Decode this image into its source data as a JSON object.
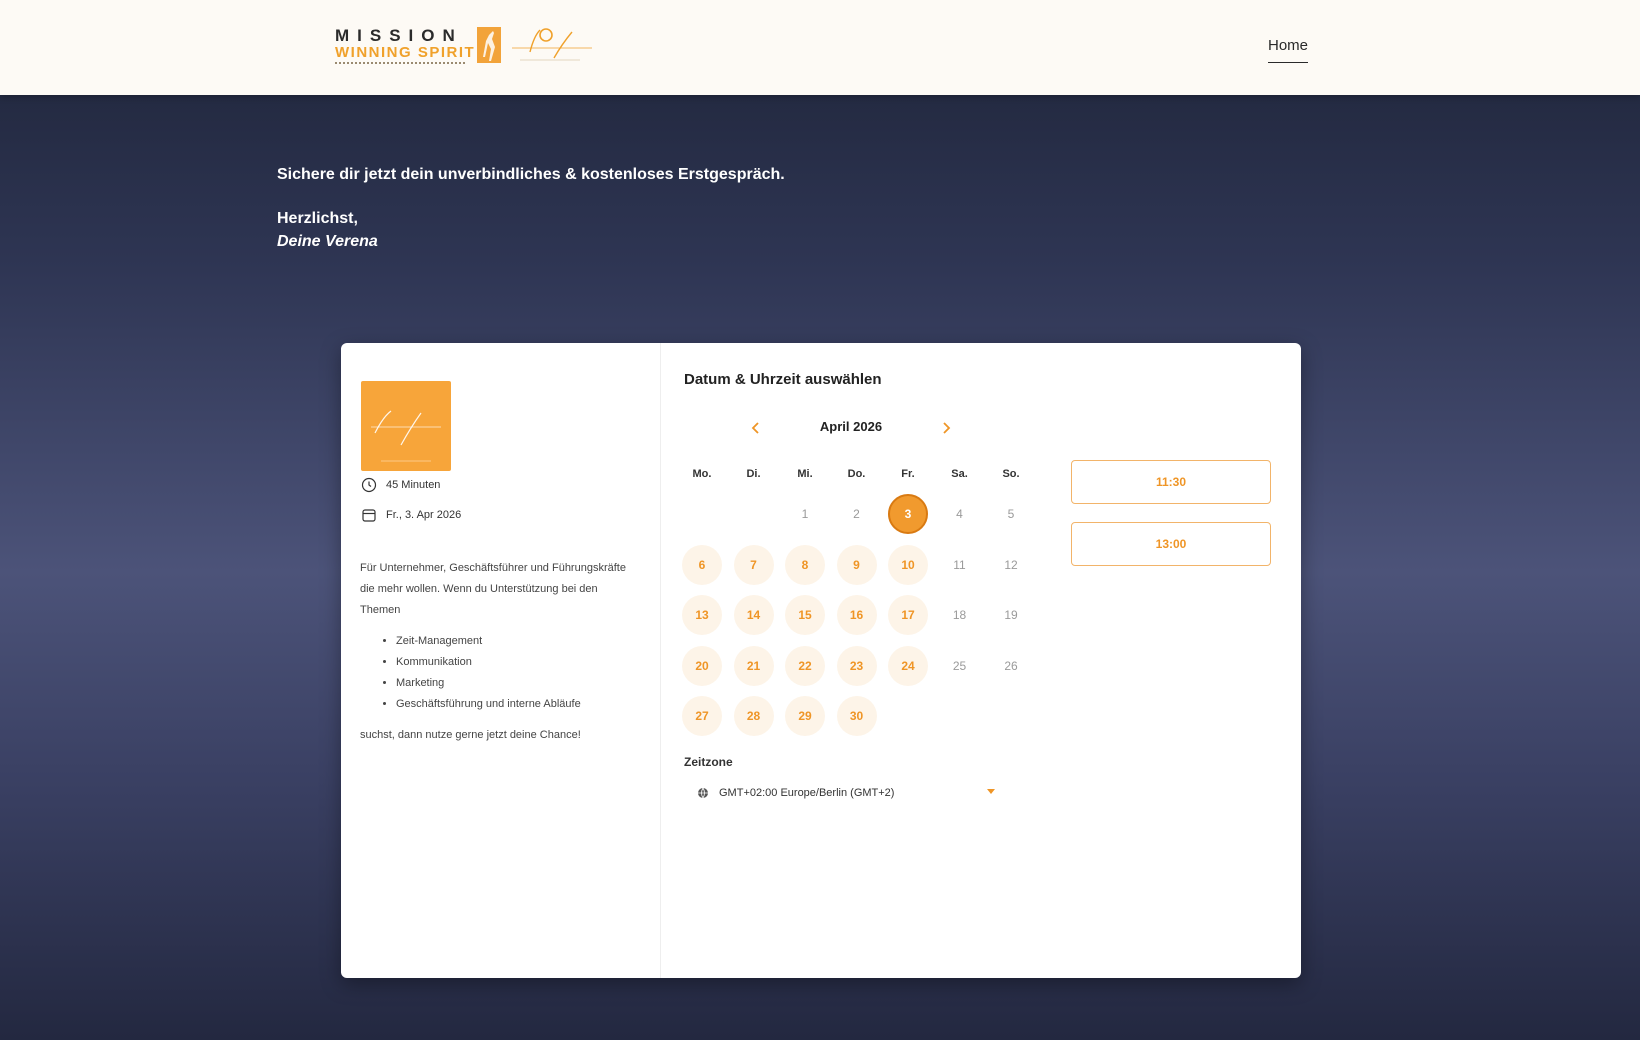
{
  "header": {
    "logo": {
      "line1": "MISSION",
      "line2": "WINNING SPIRIT",
      "signature": "VERENA LEITNER"
    },
    "nav_home": "Home"
  },
  "intro": {
    "title": "Sichere dir jetzt dein unverbindliches & kostenloses Erstgespräch.",
    "greeting": "Herzlichst,",
    "signature": "Deine Verena"
  },
  "event": {
    "image_text": "VERENA LEITNER",
    "duration": "45 Minuten",
    "date": "Fr., 3. Apr 2026",
    "description_intro": "Für Unternehmer, Geschäftsführer und Führungskräfte die mehr wollen. Wenn du Unterstützung bei den Themen",
    "topics": [
      "Zeit-Management",
      "Kommunikation",
      "Marketing",
      "Geschäftsführung und interne Abläufe"
    ],
    "description_outro": "suchst, dann nutze gerne jetzt deine Chance!"
  },
  "scheduler": {
    "title": "Datum & Uhrzeit auswählen",
    "month_label": "April 2026",
    "weekdays": [
      "Mo.",
      "Di.",
      "Mi.",
      "Do.",
      "Fr.",
      "Sa.",
      "So."
    ],
    "days": [
      {
        "n": "1",
        "state": "unavail",
        "col": 2,
        "row": 0
      },
      {
        "n": "2",
        "state": "unavail",
        "col": 3,
        "row": 0
      },
      {
        "n": "3",
        "state": "selected",
        "col": 4,
        "row": 0
      },
      {
        "n": "4",
        "state": "unavail",
        "col": 5,
        "row": 0
      },
      {
        "n": "5",
        "state": "unavail",
        "col": 6,
        "row": 0
      },
      {
        "n": "6",
        "state": "avail",
        "col": 0,
        "row": 1
      },
      {
        "n": "7",
        "state": "avail",
        "col": 1,
        "row": 1
      },
      {
        "n": "8",
        "state": "avail",
        "col": 2,
        "row": 1
      },
      {
        "n": "9",
        "state": "avail",
        "col": 3,
        "row": 1
      },
      {
        "n": "10",
        "state": "avail",
        "col": 4,
        "row": 1
      },
      {
        "n": "11",
        "state": "unavail",
        "col": 5,
        "row": 1
      },
      {
        "n": "12",
        "state": "unavail",
        "col": 6,
        "row": 1
      },
      {
        "n": "13",
        "state": "avail",
        "col": 0,
        "row": 2
      },
      {
        "n": "14",
        "state": "avail",
        "col": 1,
        "row": 2
      },
      {
        "n": "15",
        "state": "avail",
        "col": 2,
        "row": 2
      },
      {
        "n": "16",
        "state": "avail",
        "col": 3,
        "row": 2
      },
      {
        "n": "17",
        "state": "avail",
        "col": 4,
        "row": 2
      },
      {
        "n": "18",
        "state": "unavail",
        "col": 5,
        "row": 2
      },
      {
        "n": "19",
        "state": "unavail",
        "col": 6,
        "row": 2
      },
      {
        "n": "20",
        "state": "avail",
        "col": 0,
        "row": 3
      },
      {
        "n": "21",
        "state": "avail",
        "col": 1,
        "row": 3
      },
      {
        "n": "22",
        "state": "avail",
        "col": 2,
        "row": 3
      },
      {
        "n": "23",
        "state": "avail",
        "col": 3,
        "row": 3
      },
      {
        "n": "24",
        "state": "avail",
        "col": 4,
        "row": 3
      },
      {
        "n": "25",
        "state": "unavail",
        "col": 5,
        "row": 3
      },
      {
        "n": "26",
        "state": "unavail",
        "col": 6,
        "row": 3
      },
      {
        "n": "27",
        "state": "avail",
        "col": 0,
        "row": 4
      },
      {
        "n": "28",
        "state": "avail",
        "col": 1,
        "row": 4
      },
      {
        "n": "29",
        "state": "avail",
        "col": 2,
        "row": 4
      },
      {
        "n": "30",
        "state": "avail",
        "col": 3,
        "row": 4
      }
    ],
    "timezone_label": "Zeitzone",
    "timezone_value": "GMT+02:00 Europe/Berlin (GMT+2)",
    "time_slots": [
      "11:30",
      "13:00"
    ]
  },
  "colors": {
    "accent": "#ef9526",
    "header_bg": "#fdfaf5",
    "page_bg_top": "#1e2438",
    "page_bg_mid": "#4c5379"
  },
  "icons": {
    "prev": "chevron-left-icon",
    "next": "chevron-right-icon",
    "duration": "clock-icon",
    "date": "calendar-icon",
    "timezone": "globe-icon"
  }
}
